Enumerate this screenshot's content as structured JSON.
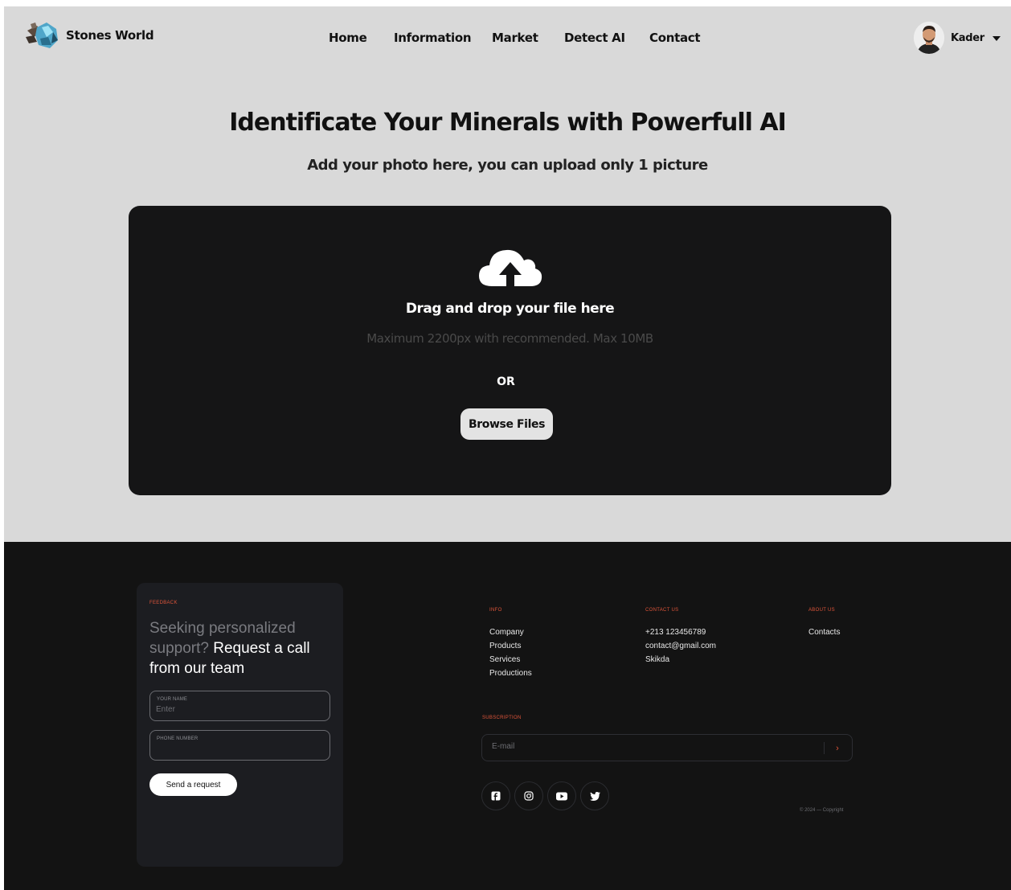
{
  "brand": {
    "name": "Stones World"
  },
  "nav": {
    "items": [
      {
        "label": "Home"
      },
      {
        "label": "Information"
      },
      {
        "label": "Market"
      },
      {
        "label": "Detect AI"
      },
      {
        "label": "Contact"
      }
    ]
  },
  "user": {
    "name": "Kader"
  },
  "hero": {
    "title": "Identificate Your Minerals with Powerfull AI",
    "subtitle": "Add your photo here, you can upload only 1 picture"
  },
  "upload": {
    "icon": "cloud-upload-icon",
    "title": "Drag and drop your file here",
    "hint": "Maximum 2200px with recommended. Max 10MB",
    "or": "OR",
    "browse_label": "Browse Files"
  },
  "footer": {
    "feedback": {
      "tag": "FEEDBACK",
      "heading_muted": "Seeking personalized support?",
      "heading_highlight": "Request a call from our team",
      "name_label": "YOUR NAME",
      "name_placeholder": "Enter",
      "phone_label": "PHONE NUMBER",
      "phone_placeholder": "",
      "send_label": "Send a request"
    },
    "info": {
      "title": "INFO",
      "items": [
        "Company",
        "Products",
        "Services",
        "Productions"
      ]
    },
    "contact": {
      "title": "CONTACT US",
      "items": [
        "+213 123456789",
        "contact@gmail.com",
        "Skikda"
      ]
    },
    "about": {
      "title": "ABOUT US",
      "items": [
        "Contacts"
      ]
    },
    "subscription": {
      "title": "SUBSCRIPTION",
      "placeholder": "E-mail",
      "submit_icon": "chevron-right-icon"
    },
    "socials": [
      "facebook-icon",
      "instagram-icon",
      "youtube-icon",
      "twitter-icon"
    ],
    "copyright": "© 2024 — Copyright"
  },
  "colors": {
    "hero_bg": "#d9d9d9",
    "dropzone_bg": "#151516",
    "footer_bg": "#131313",
    "card_bg": "#1c1d21",
    "accent": "#e0553a"
  }
}
